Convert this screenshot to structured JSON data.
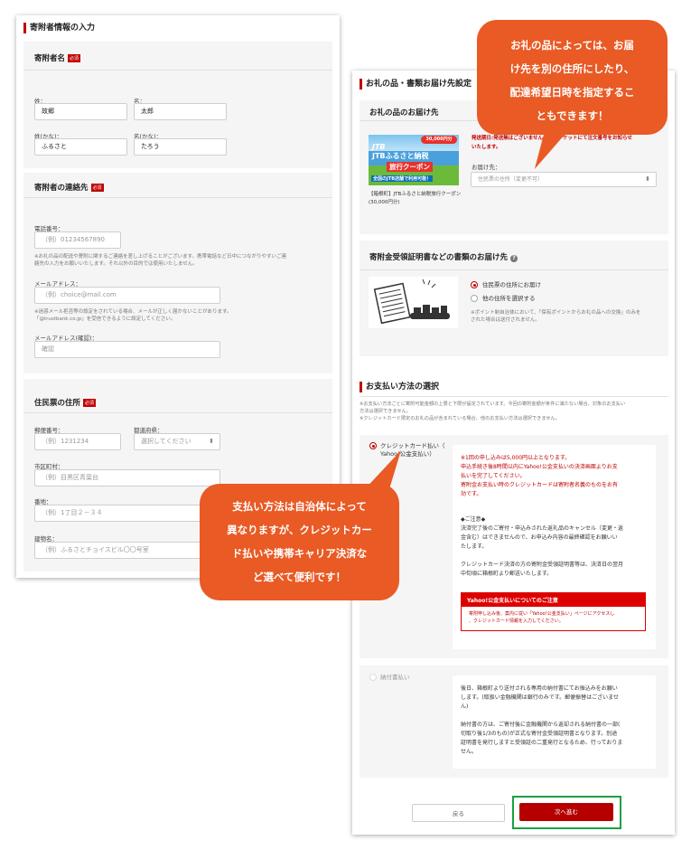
{
  "left": {
    "heading": "寄附者情報の入力",
    "name_section": {
      "title": "寄附者名",
      "required": "必須",
      "last_name_label": "姓：",
      "last_name_value": "故郷",
      "first_name_label": "名：",
      "first_name_value": "太郎",
      "last_kana_label": "姓(かな)：",
      "last_kana_value": "ふるさと",
      "first_kana_label": "名(かな)：",
      "first_kana_value": "たろう"
    },
    "contact_section": {
      "title": "寄附者の連絡先",
      "required": "必須",
      "phone_label": "電話番号：",
      "phone_placeholder": "（例）01234567890",
      "phone_note_1": "※お礼の品の配送や寄附に関するご連絡を差し上げることがございます。携帯電話など日中につながりやすいご連",
      "phone_note_2": "絡先の入力をお願いいたします。それ以外の目的では使用いたしません。",
      "email_label": "メールアドレス：",
      "email_placeholder": "（例）choice@mail.com",
      "email_note_1": "※迷惑メール拒否等の設定をされている場合、メールが正しく届かないことがあります。",
      "email_note_2": "「@trustbank.co.jp」を受信できるように設定してください。",
      "email_confirm_label": "メールアドレス(確認)：",
      "email_confirm_placeholder": "確認"
    },
    "address_section": {
      "title": "住民票の住所",
      "required": "必須",
      "postal_label": "郵便番号：",
      "postal_placeholder": "（例）1231234",
      "pref_label": "都道府県：",
      "pref_value": "選択してください",
      "city_label": "市区町村：",
      "city_placeholder": "（例）目黒区青葉台",
      "street_label": "番地：",
      "street_placeholder": "（例）1丁目２－３４",
      "building_label": "建物名：",
      "building_placeholder": "（例）ふるさとチョイスビル〇〇号室"
    }
  },
  "right": {
    "heading": "お礼の品・書類お届け先設定",
    "gift_section": {
      "title": "お礼の品のお届け先",
      "item_name": "【箱根町】JTBふるさと納税旅行クーポン(30,000円分)",
      "coupon_top": "30,000円分",
      "coupon_brand": "JTB",
      "coupon_line1": "JTBふるさと納税",
      "coupon_line2": "旅行クーポン",
      "coupon_line3": "全国のJTB店舗で利用可能！",
      "warning_1": "発送期日:発送無はございません。電子チケットにて注文番号をお知らせ",
      "warning_2": "いたします。",
      "dest_label": "お届け先：",
      "dest_value": "住民票の住所（変更不可）"
    },
    "document_section": {
      "title": "寄附金受領証明書などの書類のお届け先",
      "help_icon": "?",
      "option_1": "住民票の住所にお届け",
      "option_2": "他の住所を選択する",
      "note_1": "※ポイント制自治体において、「保有ポイントからお礼の品への交換」のみを",
      "note_2": "された場合は送付されません。"
    },
    "payment": {
      "title": "お支払い方法の選択",
      "note_1": "※お支払い方法ごとに寄附可能金額の上限と下限が設定されています。今回の寄附金額が条件に満たない場合、対象のお支払い",
      "note_2": "方法は選択できません。",
      "note_3": "※クレジットカード限定のお礼の品が含まれている場合、他のお支払い方法は選択できません。",
      "credit_label_1": "クレジットカード払い（",
      "credit_label_2": "Yahoo!公金支払い）",
      "credit_red_1": "※1回の申し込みは5,000円以上となります。",
      "credit_red_2": "申込手続き後8時間以内にYahoo!公金支払いの決済画面よりお支",
      "credit_red_3": "払いを完了してください。",
      "credit_red_4": "寄附金お支払い時のクレジットカードは寄附者名義のものをお有",
      "credit_red_5": "効です。",
      "caution_head": "◆ご注意◆",
      "caution_1": "決済完了後のご寄付・申込みされた返礼品のキャンセル（変更・返",
      "caution_2": "金含む）はできませんので、お申込み内容の最終確認をお願いい",
      "caution_3": "たします。",
      "receipt_1": "クレジットカード決済の方の寄附金受領証明書等は、決済日の翌月",
      "receipt_2": "中旬頃に箱根町より郵送いたします。",
      "yahoo_head": "Yahoo!公金支払いについてのご注意",
      "yahoo_body_1": "寄附申し込み後、案内に従い「Yahoo!公金支払い」ページにアクセスし",
      "yahoo_body_2": "、クレジットカード情報を入力してください。",
      "slip_label": "納付書払い",
      "slip_1": "後日、箱根町より送付される専用の納付書にてお振込みをお願い",
      "slip_2": "します。(取扱い金融機関は銀行のみです。郵便振替はございませ",
      "slip_3": "ん)",
      "slip_4": "納付書の方は、ご寄付後に金融機関から返却される納付書の一部(",
      "slip_5": "切取り後1/3のもの)が正式な寄付金受領証明書となります。別途",
      "slip_6": "証明書を発行しますと受領証の二重発行となるため、行っておりま",
      "slip_7": "せん。"
    },
    "back_button": "戻る",
    "next_button": "次へ進む"
  },
  "callouts": {
    "top_1": "お礼の品によっては、お届",
    "top_2": "け先を別の住所にしたり、",
    "top_3": "配達希望日時を指定するこ",
    "top_4": "ともできます！",
    "bottom_1": "支払い方法は自治体によって",
    "bottom_2": "異なりますが、クレジットカー",
    "bottom_3": "ド払いや携帯キャリア決済な",
    "bottom_4": "ど選べて便利です！"
  },
  "colors": {
    "accent_red": "#c00000",
    "callout_orange": "#e95a25",
    "highlight_green": "#1aa142"
  }
}
